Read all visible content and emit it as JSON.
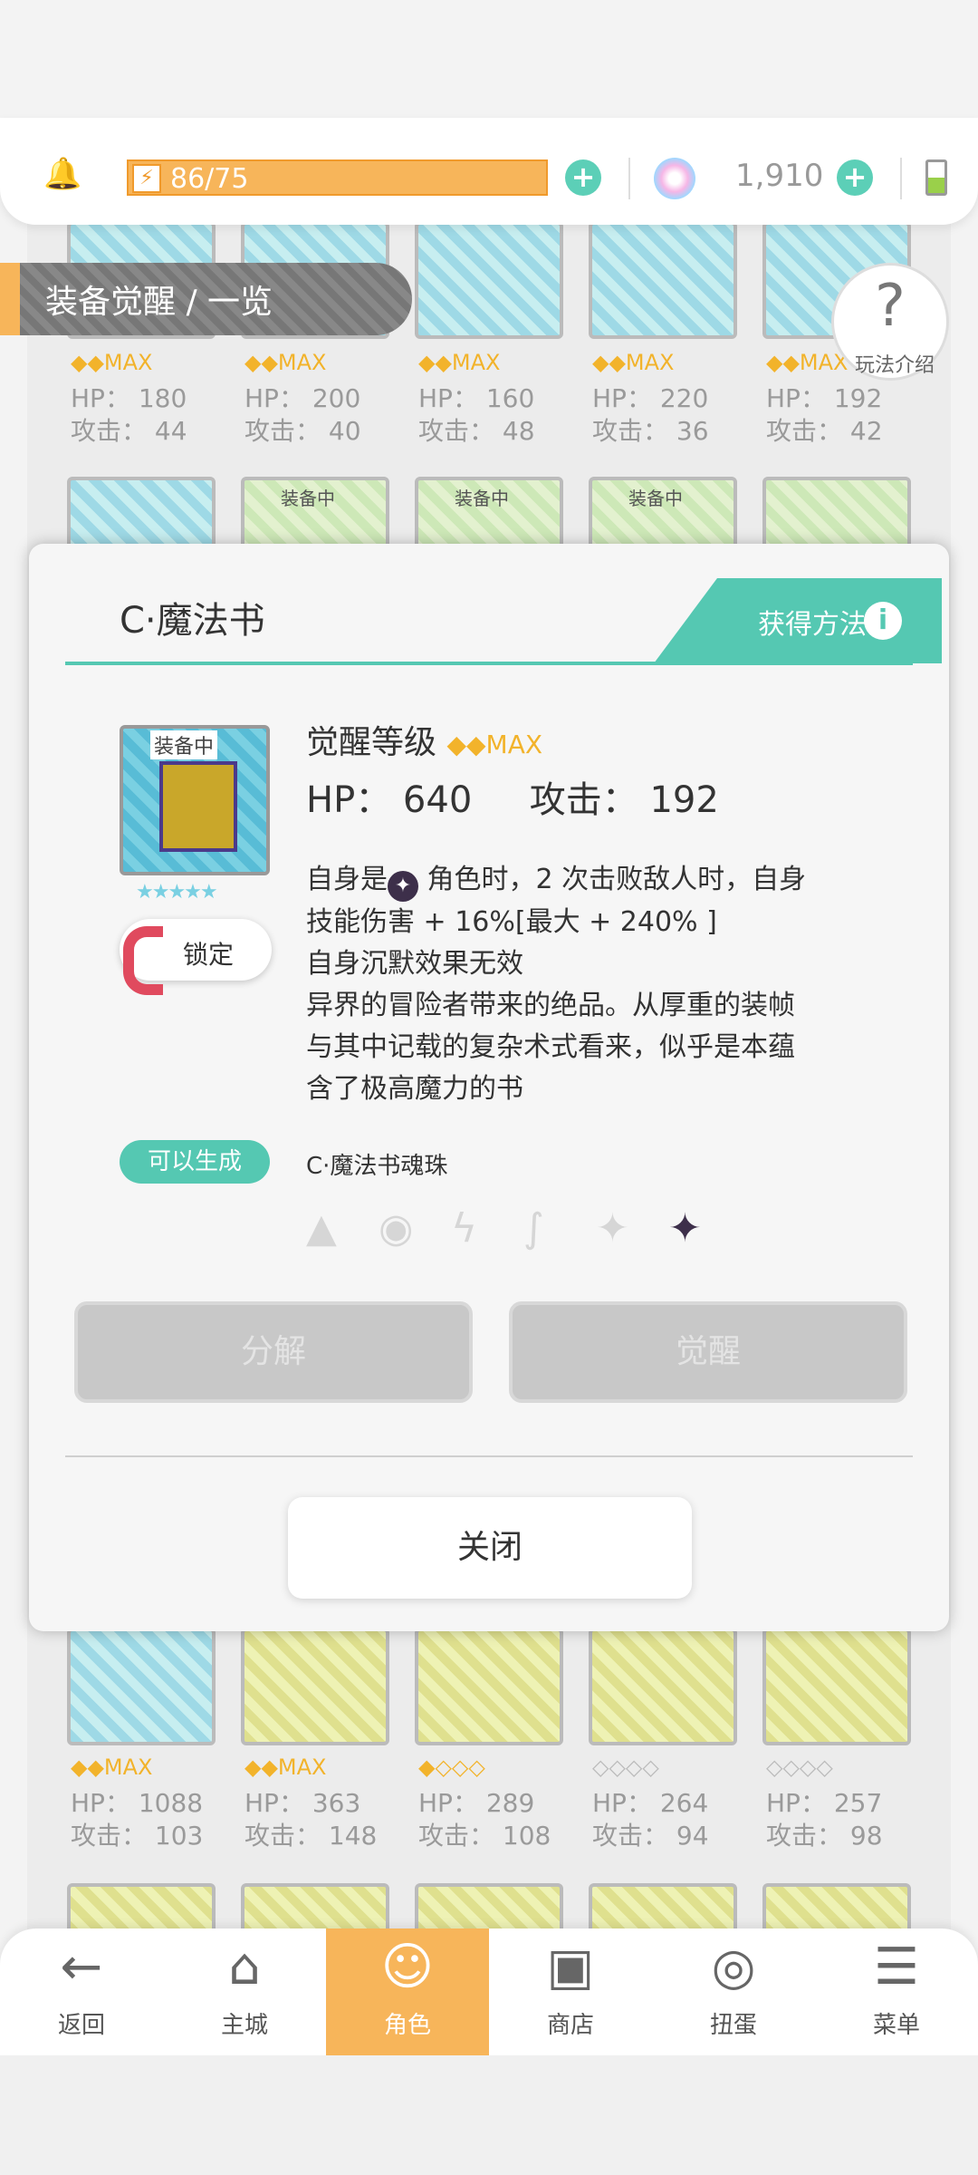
{
  "header": {
    "stamina": "86/75",
    "gems": "1,910",
    "stamina_plus": "+",
    "gem_plus": "+"
  },
  "banner": {
    "title": "装备觉醒 / 一览"
  },
  "help": {
    "q": "?",
    "label": "玩法介绍"
  },
  "grid_top": [
    {
      "hp": "HP： 180",
      "atk": "攻击： 44",
      "gems": "◆◆MAX"
    },
    {
      "hp": "HP： 200",
      "atk": "攻击： 40",
      "gems": "◆◆MAX"
    },
    {
      "hp": "HP： 160",
      "atk": "攻击： 48",
      "gems": "◆◆MAX"
    },
    {
      "hp": "HP： 220",
      "atk": "攻击： 36",
      "gems": "◆◆MAX"
    },
    {
      "hp": "HP： 192",
      "atk": "攻击： 42",
      "gems": "◆◆MAX"
    }
  ],
  "grid_mid_tags": [
    "装备中",
    "装备中",
    "装备中"
  ],
  "grid_bottom": [
    {
      "hp": "HP： 1088",
      "atk": "攻击： 103",
      "gems": "◆◆MAX"
    },
    {
      "hp": "HP： 363",
      "atk": "攻击： 148",
      "gems": "◆◆MAX"
    },
    {
      "hp": "HP： 289",
      "atk": "攻击： 108",
      "gems": "◆◇◇◇"
    },
    {
      "hp": "HP： 264",
      "atk": "攻击： 94",
      "gems": "◇◇◇◇"
    },
    {
      "hp": "HP： 257",
      "atk": "攻击： 98",
      "gems": "◇◇◇◇"
    }
  ],
  "modal": {
    "title": "C·魔法书",
    "get_method": "获得方法",
    "info_icon": "i",
    "item_tag": "装备中",
    "item_stars": "★★★★★",
    "lock_label": "锁定",
    "awaken_level_label": "觉醒等级",
    "awaken_gems": "◆◆MAX",
    "hp_label": "HP：",
    "hp_value": "640",
    "atk_label": "攻击：",
    "atk_value": "192",
    "desc_line1_a": "自身是",
    "desc_line1_b": "角色时，2 次击败敌人时，自身",
    "desc_line2": "技能伤害 + 16%[最大 + 240% ]",
    "desc_line3": "自身沉默效果无效",
    "desc_line4": "异界的冒险者带来的绝品。从厚重的装帧",
    "desc_line5": "与其中记载的复杂术式看来，似乎是本蕴",
    "desc_line6": "含了极高魔力的书",
    "can_generate": "可以生成",
    "soul_orb": "C·魔法书魂珠",
    "attrs": [
      "▲",
      "◉",
      "ϟ",
      "∫",
      "✦",
      "✦"
    ],
    "decompose": "分解",
    "awaken": "觉醒",
    "close": "关闭"
  },
  "nav": [
    {
      "icon": "←",
      "label": "返回"
    },
    {
      "icon": "⌂",
      "label": "主城"
    },
    {
      "icon": "☺",
      "label": "角色"
    },
    {
      "icon": "▣",
      "label": "商店"
    },
    {
      "icon": "◎",
      "label": "扭蛋"
    },
    {
      "icon": "☰",
      "label": "菜单"
    }
  ]
}
